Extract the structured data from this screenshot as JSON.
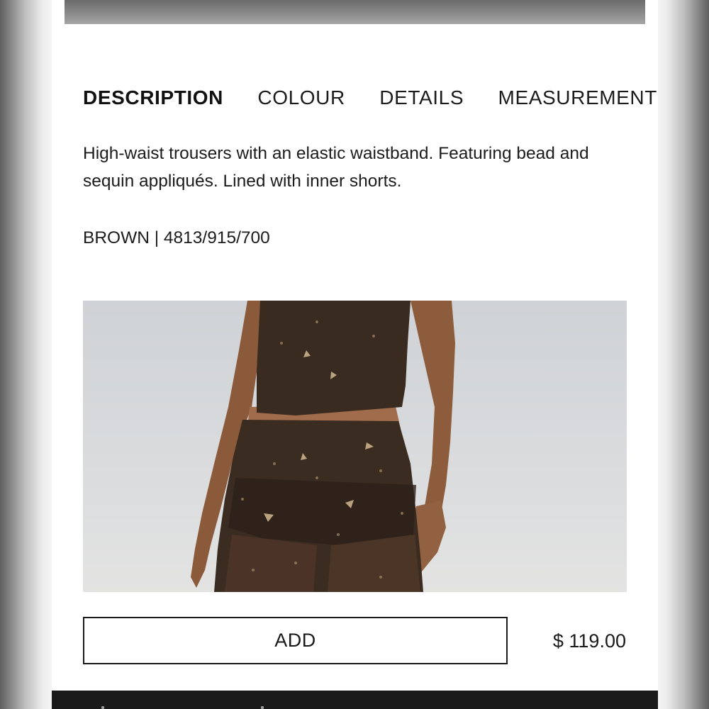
{
  "tabs": [
    {
      "label": "DESCRIPTION",
      "active": true
    },
    {
      "label": "COLOUR",
      "active": false
    },
    {
      "label": "DETAILS",
      "active": false
    },
    {
      "label": "MEASUREMENT",
      "active": false
    }
  ],
  "product": {
    "description": "High-waist trousers with an elastic waistband. Featuring bead and sequin appliqués. Lined with inner shorts.",
    "colour_ref": "BROWN | 4813/915/700",
    "price": "$ 119.00"
  },
  "actions": {
    "add_label": "ADD"
  },
  "colors": {
    "accent": "#1a1a1a",
    "garment": "#3b2c22",
    "skin": "#8a5a3b"
  }
}
